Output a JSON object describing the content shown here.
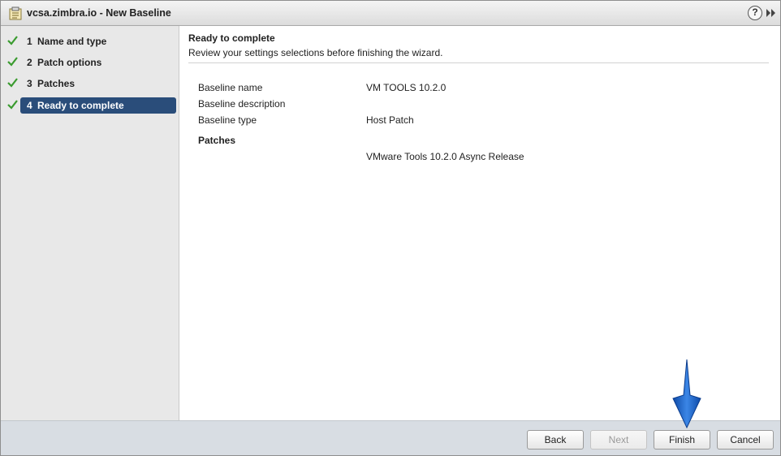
{
  "window": {
    "title": "vcsa.zimbra.io - New Baseline",
    "help_glyph": "?"
  },
  "steps": [
    {
      "num": "1",
      "label": "Name and type",
      "completed": true,
      "active": false
    },
    {
      "num": "2",
      "label": "Patch options",
      "completed": true,
      "active": false
    },
    {
      "num": "3",
      "label": "Patches",
      "completed": true,
      "active": false
    },
    {
      "num": "4",
      "label": "Ready to complete",
      "completed": true,
      "active": true
    }
  ],
  "main": {
    "title": "Ready to complete",
    "subtitle": "Review your settings selections before finishing the wizard.",
    "rows": [
      {
        "label": "Baseline name",
        "value": "VM TOOLS 10.2.0"
      },
      {
        "label": "Baseline description",
        "value": ""
      },
      {
        "label": "Baseline type",
        "value": "Host Patch"
      }
    ],
    "patches_heading": "Patches",
    "patches": [
      "VMware Tools 10.2.0 Async Release"
    ]
  },
  "footer": {
    "back_label": "Back",
    "next_label": "Next",
    "finish_label": "Finish",
    "cancel_label": "Cancel"
  },
  "colors": {
    "active_step_bg": "#2a4d7a",
    "check_green": "#3a9b2f",
    "annotation_arrow": "#1a5fc0"
  }
}
